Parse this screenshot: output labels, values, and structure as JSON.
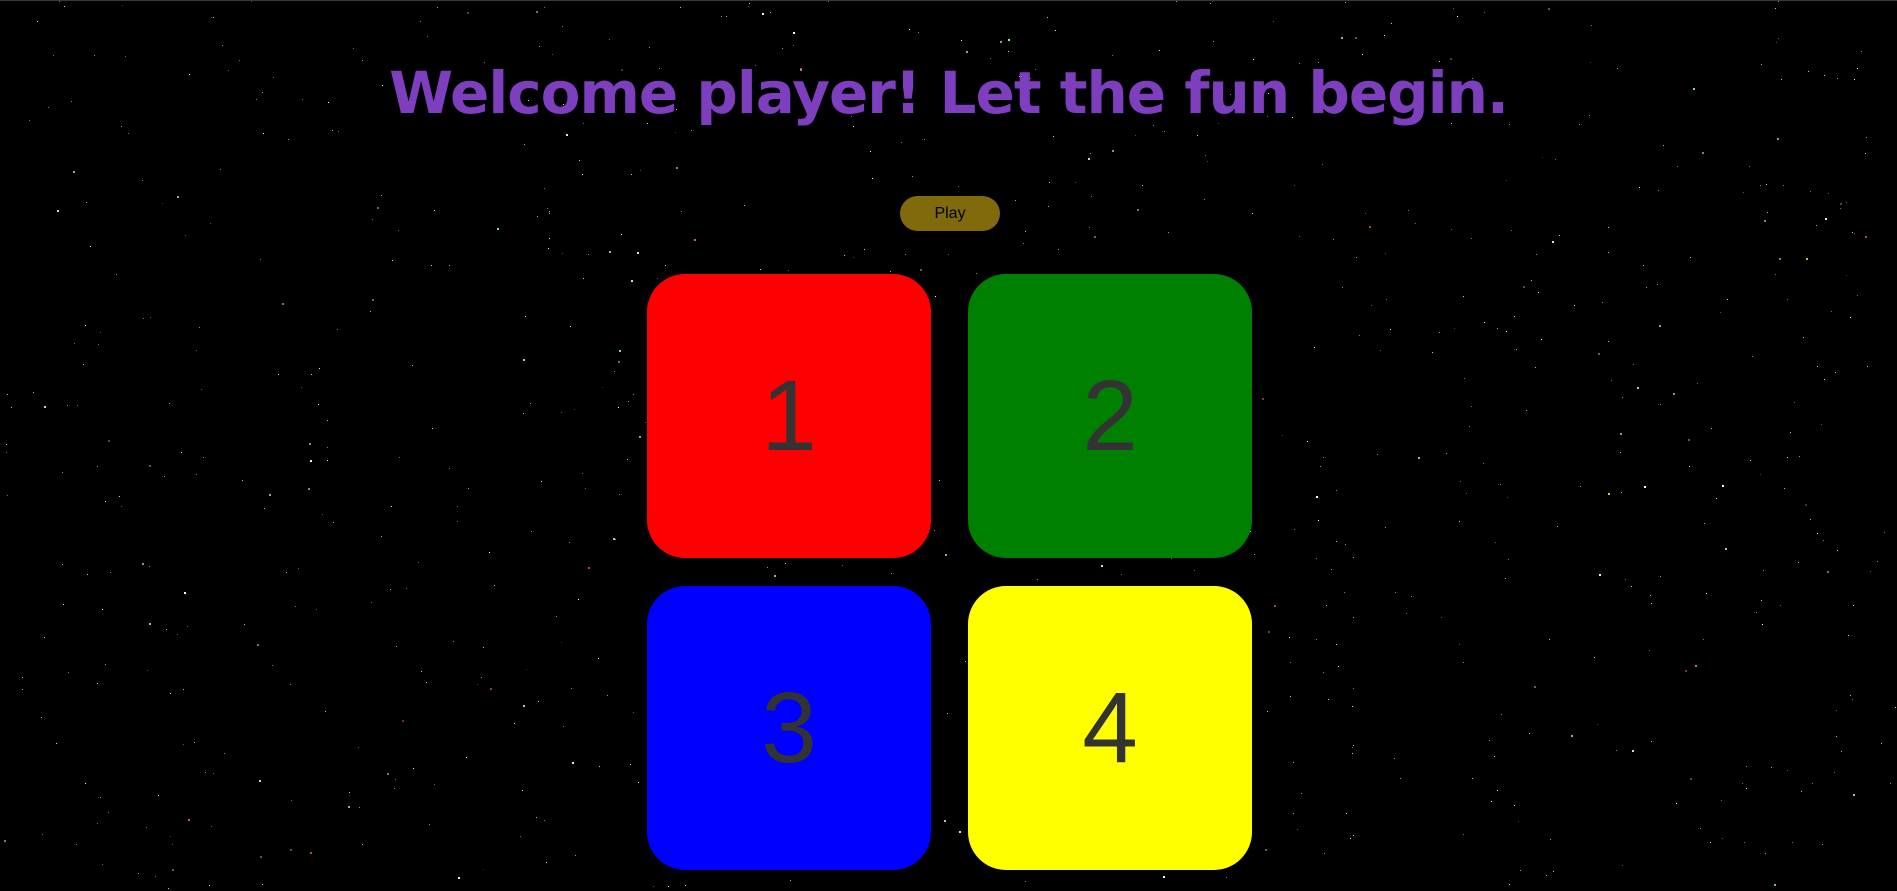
{
  "header": {
    "title": "Welcome player! Let the fun begin."
  },
  "controls": {
    "play_label": "Play"
  },
  "tiles": [
    {
      "label": "1",
      "color": "#ff0000"
    },
    {
      "label": "2",
      "color": "#008000"
    },
    {
      "label": "3",
      "color": "#0000ff"
    },
    {
      "label": "4",
      "color": "#ffff00"
    }
  ],
  "theme": {
    "background": "#000000",
    "title_color": "#7e3fbf",
    "play_button_color": "#806a0b",
    "tile_text_color": "#333333"
  }
}
